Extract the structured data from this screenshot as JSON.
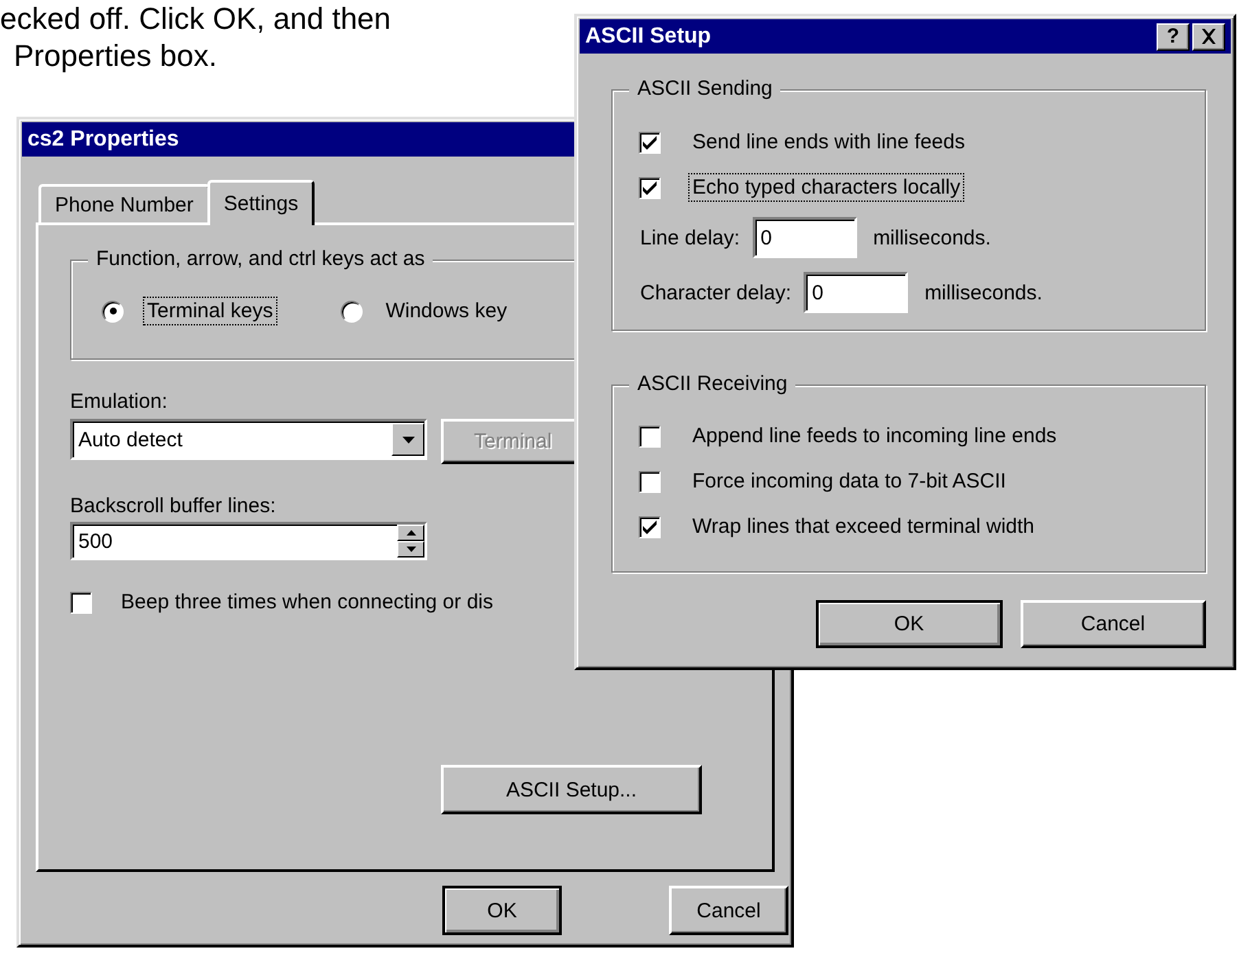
{
  "document_text": [
    "ecked off. Click OK, and then",
    "Properties box."
  ],
  "back_window": {
    "title": "cs2 Properties",
    "tabs": [
      {
        "label": "Phone Number",
        "selected": false
      },
      {
        "label": "Settings",
        "selected": true
      }
    ],
    "key_group": {
      "title": "Function, arrow, and ctrl keys act as",
      "options": [
        {
          "label": "Terminal keys",
          "selected": true,
          "focused": true
        },
        {
          "label": "Windows key",
          "selected": false,
          "focused": false
        }
      ]
    },
    "emulation": {
      "label": "Emulation:",
      "value": "Auto detect"
    },
    "terminal_button": {
      "label": "Terminal",
      "disabled": true
    },
    "backscroll": {
      "label": "Backscroll buffer lines:",
      "value": "500"
    },
    "beep": {
      "label": "Beep three times when connecting or dis",
      "checked": false
    },
    "ascii_button": "ASCII Setup...",
    "buttons": [
      "OK",
      "Cancel"
    ]
  },
  "front_window": {
    "title": "ASCII Setup",
    "help_button": "?",
    "sending": {
      "title": "ASCII Sending",
      "checks": [
        {
          "label": "Send line ends with line feeds",
          "checked": true,
          "focused": false
        },
        {
          "label": "Echo typed characters locally",
          "checked": true,
          "focused": true
        }
      ],
      "delays": [
        {
          "label": "Line delay:",
          "value": "0",
          "unit": "milliseconds."
        },
        {
          "label": "Character delay:",
          "value": "0",
          "unit": "milliseconds."
        }
      ]
    },
    "receiving": {
      "title": "ASCII Receiving",
      "checks": [
        {
          "label": "Append line feeds to incoming line ends",
          "checked": false,
          "focused": false
        },
        {
          "label": "Force incoming data to 7-bit ASCII",
          "checked": false,
          "focused": false
        },
        {
          "label": "Wrap lines that exceed terminal width",
          "checked": true,
          "focused": false
        }
      ]
    },
    "buttons": [
      "OK",
      "Cancel"
    ]
  }
}
